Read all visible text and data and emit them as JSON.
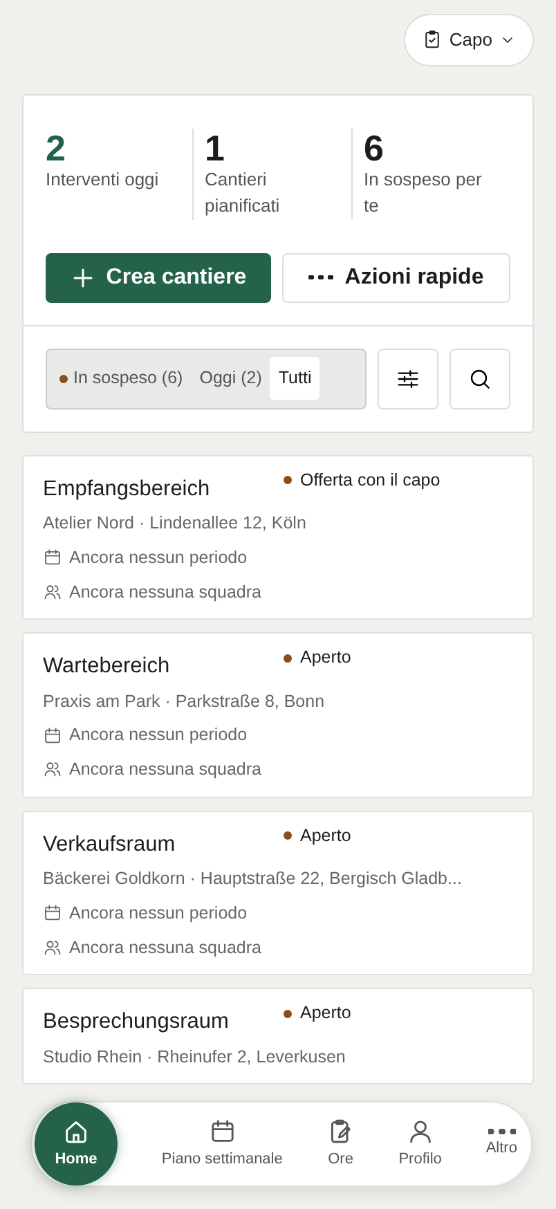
{
  "role_menu": {
    "label": "Capo"
  },
  "stats": [
    {
      "value": "2",
      "label": "Interventi oggi",
      "highlight": true
    },
    {
      "value": "1",
      "label": "Cantieri pianificati",
      "highlight": false
    },
    {
      "value": "6",
      "label": "In sospeso per te",
      "highlight": false
    }
  ],
  "actions": [
    {
      "label": "Crea cantiere",
      "kind": "primary"
    },
    {
      "label": "Azioni rapide",
      "kind": "secondary"
    }
  ],
  "filters": [
    {
      "label": "In sospeso (6)",
      "selected": false,
      "dot": true
    },
    {
      "label": "Oggi (2)",
      "selected": false,
      "dot": false
    },
    {
      "label": "Tutti",
      "selected": true,
      "dot": false
    }
  ],
  "sites": [
    {
      "title": "Empfangsbereich",
      "status": "Offerta con il capo",
      "color": "#8b4d1a",
      "address": "Atelier Nord · Lindenallee 12, Köln",
      "period": "Ancora nessun periodo",
      "team": "Ancora nessuna squadra"
    },
    {
      "title": "Wartebereich",
      "status": "Aperto",
      "color": "#8b4d1a",
      "address": "Praxis am Park · Parkstraße 8, Bonn",
      "period": "Ancora nessun periodo",
      "team": "Ancora nessuna squadra"
    },
    {
      "title": "Verkaufsraum",
      "status": "Aperto",
      "color": "#8b4d1a",
      "address": "Bäckerei Goldkorn · Hauptstraße 22, Bergisch Gladb...",
      "period": "Ancora nessun periodo",
      "team": "Ancora nessuna squadra"
    },
    {
      "title": "Besprechungsraum",
      "status": "Aperto",
      "color": "#8b4d1a",
      "address": "Studio Rhein · Rheinufer 2, Leverkusen"
    }
  ],
  "bottom_nav": [
    {
      "label": "Home",
      "kind": "home",
      "selected": true
    },
    {
      "label": "Piano settimanale",
      "kind": "calendar",
      "selected": false
    },
    {
      "label": "Ore",
      "kind": "clipboard",
      "selected": false
    },
    {
      "label": "Profilo",
      "kind": "person",
      "selected": false
    },
    {
      "label": "Altro",
      "kind": "more",
      "selected": false
    }
  ]
}
